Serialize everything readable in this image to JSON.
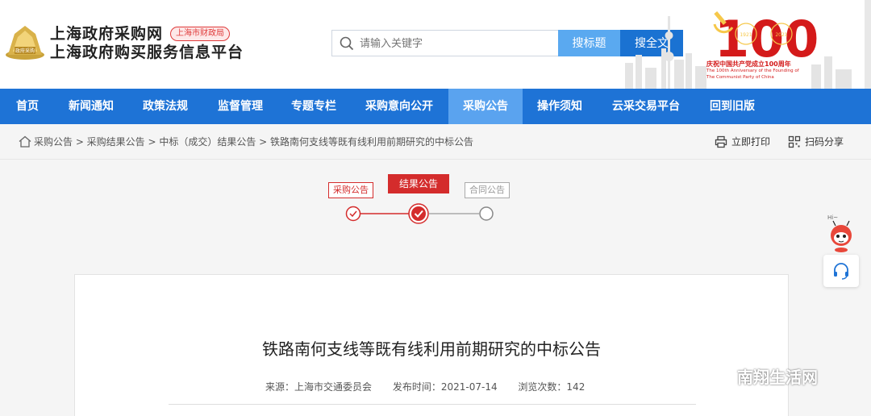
{
  "header": {
    "site_title_1": "上海政府采购网",
    "site_title_2": "上海政府购买服务信息平台",
    "bureau_tag": "上海市财政局",
    "emblem_text": "政府采购",
    "search_placeholder": "请输入关键字",
    "search_title_button": "搜标题",
    "search_full_button": "搜全文",
    "anniversary": {
      "number": "100",
      "years": [
        "1921",
        "2021"
      ],
      "line1": "庆祝中国共产党成立100周年",
      "line2": "The 100th Anniversary of the Founding of",
      "line3": "The Communist Party of China"
    }
  },
  "nav": {
    "items": [
      {
        "label": "首页",
        "active": false
      },
      {
        "label": "新闻通知",
        "active": false
      },
      {
        "label": "政策法规",
        "active": false
      },
      {
        "label": "监督管理",
        "active": false
      },
      {
        "label": "专题专栏",
        "active": false
      },
      {
        "label": "采购意向公开",
        "active": false
      },
      {
        "label": "采购公告",
        "active": true
      },
      {
        "label": "操作须知",
        "active": false
      },
      {
        "label": "云采交易平台",
        "active": false
      },
      {
        "label": "回到旧版",
        "active": false
      }
    ]
  },
  "breadcrumb": {
    "path": "采购公告 > 采购结果公告 > 中标（成交）结果公告 > 铁路南何支线等既有线利用前期研究的中标公告",
    "print_label": "立即打印",
    "share_label": "扫码分享"
  },
  "progress": {
    "steps": [
      {
        "label": "采购公告",
        "state": "done"
      },
      {
        "label": "结果公告",
        "state": "current"
      },
      {
        "label": "合同公告",
        "state": "pending"
      }
    ]
  },
  "floating": {
    "mascot_bubble": "Hi~"
  },
  "article": {
    "title": "铁路南何支线等既有线利用前期研究的中标公告",
    "source": "来源：上海市交通委员会",
    "publish_time": "发布时间：2021-07-14",
    "views": "浏览次数：142"
  },
  "watermark": {
    "text": "南翔生活网"
  },
  "colors": {
    "nav_blue": "#1e73d6",
    "nav_active": "#5aa3ef",
    "party_red": "#d42c2c",
    "search_light": "#5aa9f0",
    "search_dark": "#1a72d2"
  }
}
